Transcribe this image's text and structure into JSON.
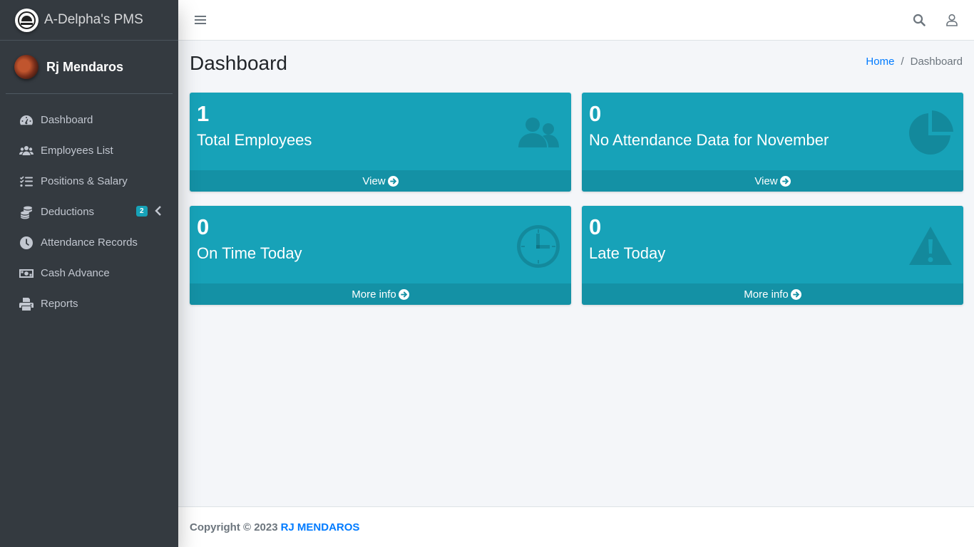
{
  "brand": {
    "title": "A-Delpha's PMS"
  },
  "user": {
    "name": "Rj Mendaros"
  },
  "sidebar": {
    "items": [
      {
        "label": "Dashboard",
        "icon": "tachometer-icon"
      },
      {
        "label": "Employees List",
        "icon": "users-icon"
      },
      {
        "label": "Positions & Salary",
        "icon": "list-check-icon"
      },
      {
        "label": "Deductions",
        "icon": "coins-icon",
        "badge": "2"
      },
      {
        "label": "Attendance Records",
        "icon": "clock-icon"
      },
      {
        "label": "Cash Advance",
        "icon": "money-bill-icon"
      },
      {
        "label": "Reports",
        "icon": "print-icon"
      }
    ]
  },
  "header": {
    "menu_icon": "bars-icon",
    "search_icon": "search-icon",
    "user_icon": "user-icon"
  },
  "page": {
    "title": "Dashboard",
    "breadcrumb": {
      "home": "Home",
      "current": "Dashboard"
    }
  },
  "boxes": [
    {
      "number": "1",
      "text": "Total Employees",
      "footer": "View",
      "icon": "users-icon"
    },
    {
      "number": "0",
      "text": "No Attendance Data for November",
      "footer": "View",
      "icon": "pie-chart-icon"
    },
    {
      "number": "0",
      "text": "On Time Today",
      "footer": "More info",
      "icon": "clock-icon"
    },
    {
      "number": "0",
      "text": "Late Today",
      "footer": "More info",
      "icon": "warning-icon"
    }
  ],
  "footer": {
    "copyright": "Copyright © 2023",
    "owner": "RJ MENDAROS"
  },
  "colors": {
    "sidebar": "#343a40",
    "accent": "#17a2b8",
    "link": "#007bff",
    "background": "#f4f6f9"
  }
}
